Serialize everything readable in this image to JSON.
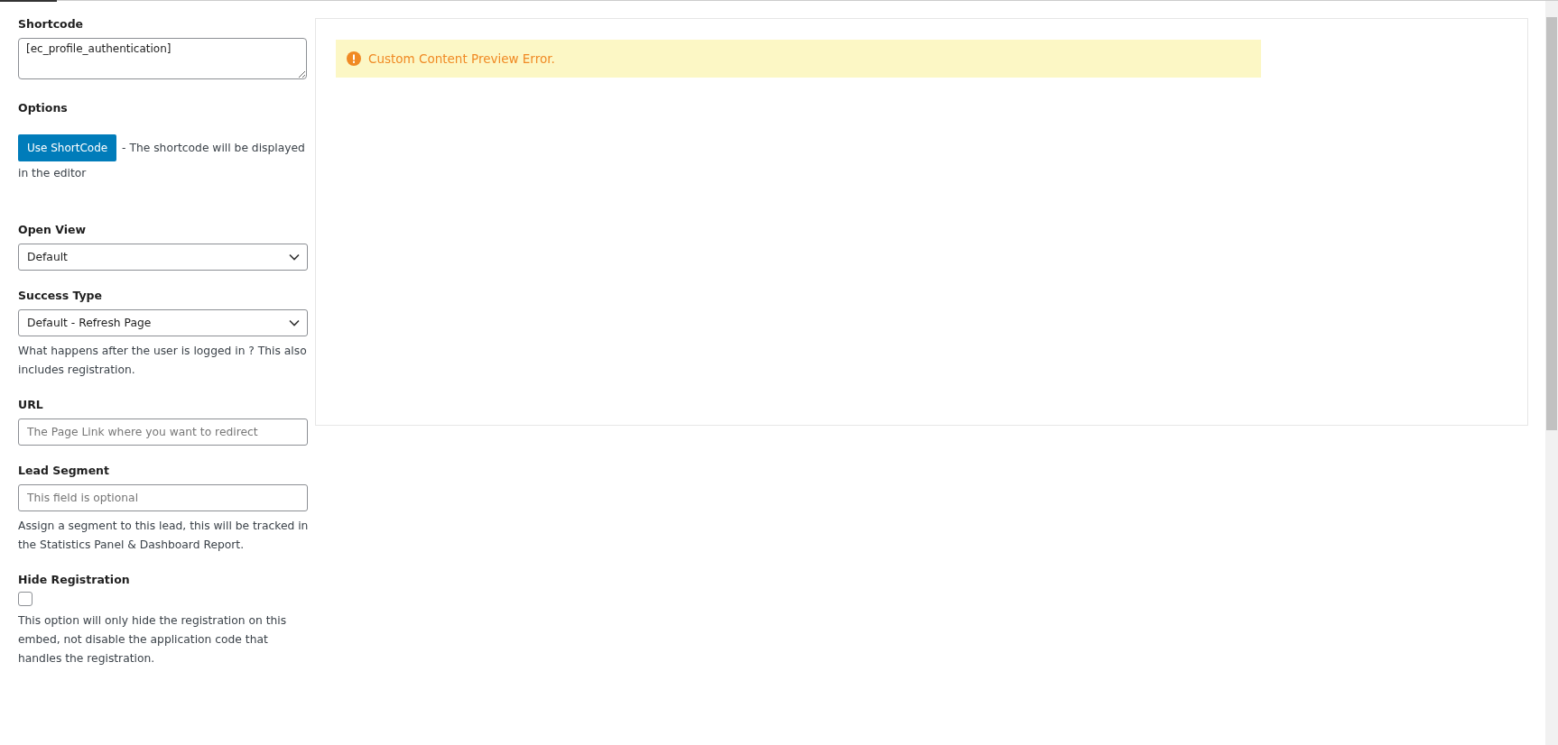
{
  "settings": [
    {
      "kind": "textarea",
      "label": "Shortcode",
      "value": "[ec_profile_authentication]"
    },
    {
      "kind": "button",
      "label": "Options",
      "button": "Use ShortCode",
      "help": "- The shortcode will be displayed in the editor"
    },
    {
      "kind": "select",
      "label": "Open View",
      "value": "Default"
    },
    {
      "kind": "select",
      "label": "Success Type",
      "value": "Default - Refresh Page",
      "help": "What happens after the user is logged in ? This also includes registration."
    },
    {
      "kind": "input",
      "label": "URL",
      "placeholder": "The Page Link where you want to redirect"
    },
    {
      "kind": "input",
      "label": "Lead Segment",
      "placeholder": "This field is optional",
      "help": "Assign a segment to this lead, this will be tracked in the Statistics Panel & Dashboard Report."
    },
    {
      "kind": "checkbox",
      "label": "Hide Registration",
      "checked": false,
      "help": "This option will only hide the registration on this embed, not disable the application code that handles the registration."
    }
  ],
  "preview": {
    "notice": "Custom Content Preview Error."
  }
}
